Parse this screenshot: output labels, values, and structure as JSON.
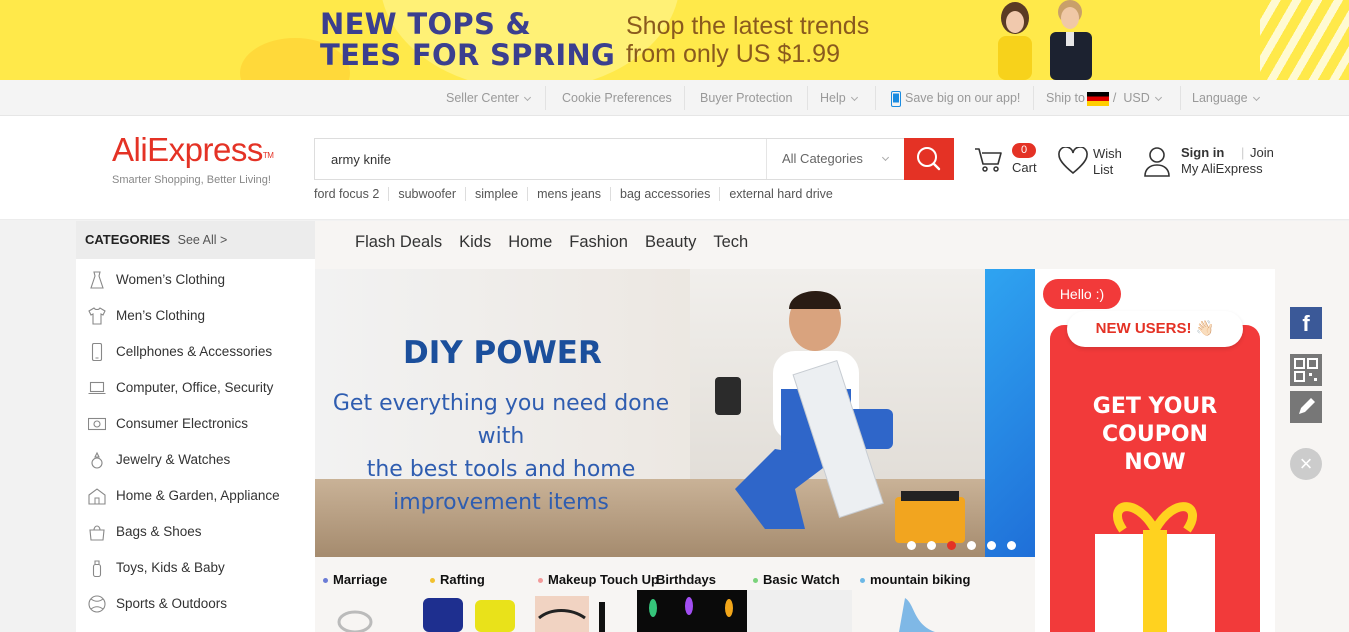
{
  "promo": {
    "title_line1": "NEW TOPS &",
    "title_line2": "TEES FOR SPRING",
    "subtitle_line1": "Shop the latest trends",
    "subtitle_line2": "from only US $1.99"
  },
  "utility_nav": {
    "seller_center": "Seller Center",
    "cookie_prefs": "Cookie Preferences",
    "buyer_protection": "Buyer Protection",
    "help": "Help",
    "save_app": "Save big on our app!",
    "ship_to": "Ship to",
    "currency": "USD",
    "language": "Language"
  },
  "header": {
    "logo": "AliExpress",
    "logo_tm": "TM",
    "tagline": "Smarter Shopping, Better Living!",
    "search_value": "army knife",
    "search_category": "All Categories",
    "hot_words": [
      "ford focus 2",
      "subwoofer",
      "simplee",
      "mens jeans",
      "bag accessories",
      "external hard drive"
    ],
    "cart_count": "0",
    "cart_label": "Cart",
    "wish_line1": "Wish",
    "wish_line2": "List",
    "sign_in": "Sign in",
    "join": "Join",
    "my_account": "My AliExpress"
  },
  "categories": {
    "title": "CATEGORIES",
    "see_all": "See All >",
    "items": [
      {
        "label": "Women’s Clothing",
        "icon": "dress-icon"
      },
      {
        "label": "Men’s Clothing",
        "icon": "shirt-icon"
      },
      {
        "label": "Cellphones & Accessories",
        "icon": "phone-icon"
      },
      {
        "label": "Computer, Office, Security",
        "icon": "laptop-icon"
      },
      {
        "label": "Consumer Electronics",
        "icon": "camera-icon"
      },
      {
        "label": "Jewelry & Watches",
        "icon": "ring-icon"
      },
      {
        "label": "Home & Garden, Appliance",
        "icon": "home-icon"
      },
      {
        "label": "Bags & Shoes",
        "icon": "bag-icon"
      },
      {
        "label": "Toys, Kids & Baby",
        "icon": "bottle-icon"
      },
      {
        "label": "Sports & Outdoors",
        "icon": "ball-icon"
      }
    ]
  },
  "tabs": [
    "Flash Deals",
    "Kids",
    "Home",
    "Fashion",
    "Beauty",
    "Tech"
  ],
  "hero": {
    "title": "DIY POWER",
    "line1": "Get everything you need done with",
    "line2": "the best tools and home",
    "line3": "improvement items",
    "active_slide": 3,
    "slide_count": 6
  },
  "themes": [
    {
      "label": "Marriage",
      "color": "#6b7cd6"
    },
    {
      "label": "Rafting",
      "color": "#f2c12e"
    },
    {
      "label": "Makeup Touch Up",
      "color": "#f29a9a"
    },
    {
      "label": "Birthdays",
      "color": "#f29a9a"
    },
    {
      "label": "Basic Watch",
      "color": "#7bd37b"
    },
    {
      "label": "mountain biking",
      "color": "#6cb8e6"
    }
  ],
  "coupon": {
    "hello": "Hello :)",
    "new_users": "NEW USERS! 👋🏻",
    "line1": "GET YOUR",
    "line2": "COUPON",
    "line3": "NOW"
  },
  "share": {
    "facebook": "f",
    "close": "×"
  },
  "colors": {
    "brand": "#e43225",
    "promo_bg": "#ffe94a",
    "promo_title": "#3b3f8f",
    "hero_title": "#1b4f9c",
    "facebook": "#3b5998"
  }
}
